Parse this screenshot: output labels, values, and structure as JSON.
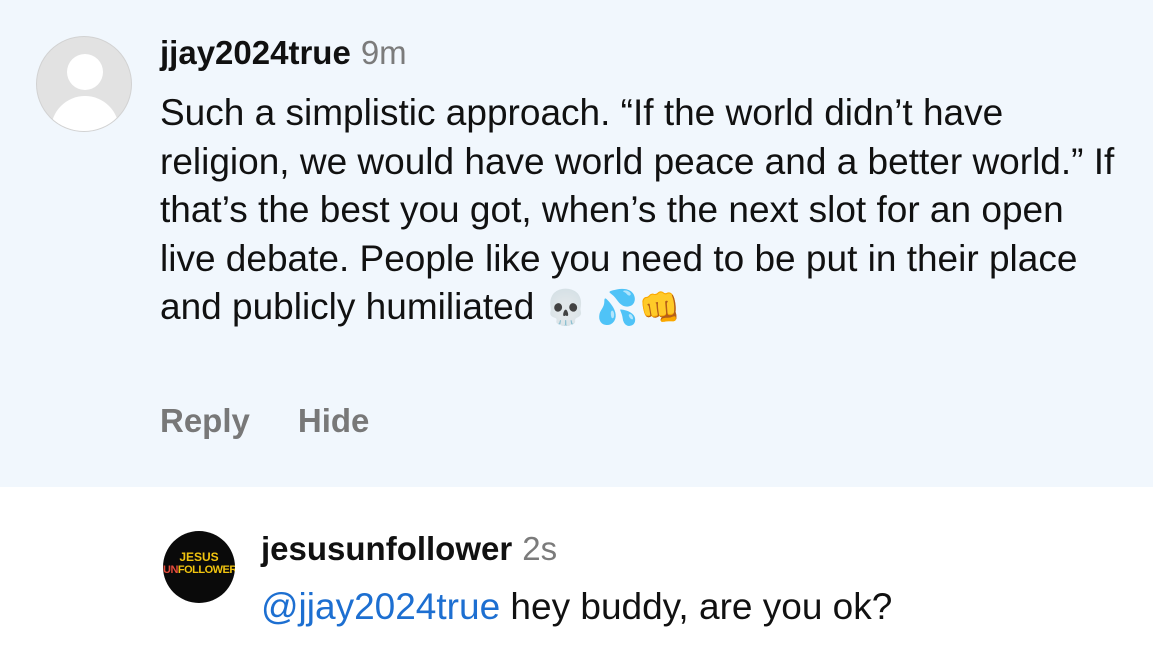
{
  "comment_1": {
    "username": "jjay2024true",
    "time": "9m",
    "text": "Such a simplistic approach. “If the world didn’t have religion, we would have world peace and a better world.” If that’s the best you got, when’s the next slot for an open live debate. People like you need to be put in their place and publicly humiliated",
    "emojis": "💀 💦👊",
    "reply_label": "Reply",
    "hide_label": "Hide",
    "avatar_icon": "default-user-icon",
    "background": "#f1f7fd"
  },
  "comment_2": {
    "username": "jesusunfollower",
    "time": "2s",
    "mention": "@jjay2024true",
    "text": " hey buddy, are you ok?",
    "avatar": {
      "line1": "JESUS",
      "line2_red": "UN",
      "line2_rest": "FOLLOWER"
    }
  },
  "colors": {
    "mention": "#1d6fd1",
    "meta_text": "#7b7b7b",
    "brand_yellow": "#f1c40f",
    "brand_red": "#e74c3c"
  }
}
